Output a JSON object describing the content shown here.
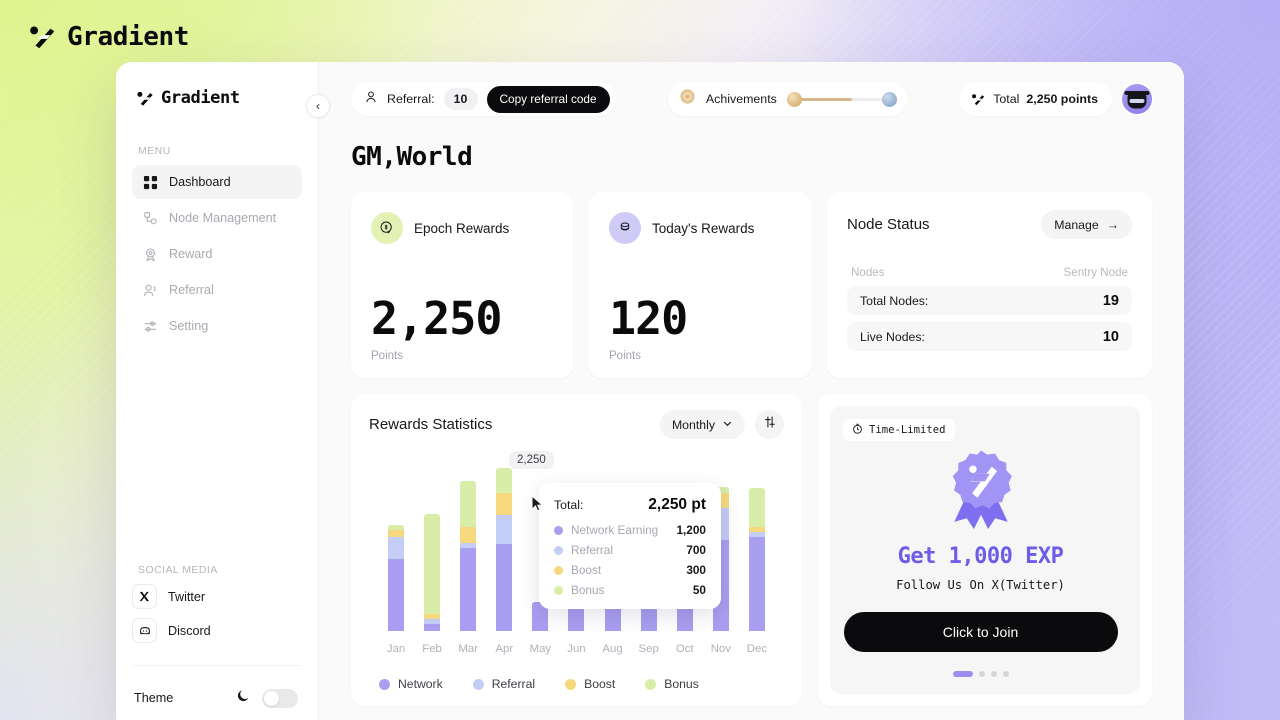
{
  "brand": {
    "name": "Gradient"
  },
  "sidebar": {
    "menu_label": "MENU",
    "items": [
      {
        "label": "Dashboard",
        "icon": "grid-icon"
      },
      {
        "label": "Node Management",
        "icon": "node-icon"
      },
      {
        "label": "Reward",
        "icon": "reward-icon"
      },
      {
        "label": "Referral",
        "icon": "users-icon"
      },
      {
        "label": "Setting",
        "icon": "sliders-icon"
      }
    ],
    "social_label": "SOCIAL MEDIA",
    "social": [
      {
        "label": "Twitter",
        "icon": "x-twitter-icon"
      },
      {
        "label": "Discord",
        "icon": "discord-icon"
      }
    ],
    "theme": {
      "label": "Theme",
      "mode_icon": "moon-icon",
      "enabled": false
    },
    "collapse_icon": "chevron-left-icon"
  },
  "topbar": {
    "referral_label": "Referral:",
    "referral_count": "10",
    "copy_button": "Copy referral code",
    "achievements_label": "Achivements",
    "achievements_progress": 52,
    "total_label": "Total",
    "total_value": "2,250 points",
    "avatar": "user-avatar"
  },
  "page": {
    "title": "GM,World"
  },
  "cards": {
    "epoch": {
      "title": "Epoch Rewards",
      "value": "2,250",
      "unit": "Points",
      "icon": "coins-icon"
    },
    "today": {
      "title": "Today's Rewards",
      "value": "120",
      "unit": "Points",
      "icon": "stack-icon"
    }
  },
  "node_status": {
    "title": "Node Status",
    "manage_label": "Manage",
    "col_left": "Nodes",
    "col_right": "Sentry Node",
    "rows": [
      {
        "label": "Total Nodes:",
        "value": "19"
      },
      {
        "label": "Live Nodes:",
        "value": "10"
      }
    ]
  },
  "stats": {
    "title": "Rewards Statistics",
    "range_label": "Monthly",
    "filter_icon": "sliders-icon",
    "highlight_value": "2,250",
    "tooltip": {
      "total_label": "Total:",
      "total_value": "2,250 pt",
      "rows": [
        {
          "label": "Network Earning",
          "value": "1,200",
          "color": "#a99ef0"
        },
        {
          "label": "Referral",
          "value": "700",
          "color": "#c3cdf6"
        },
        {
          "label": "Boost",
          "value": "300",
          "color": "#f6d97e"
        },
        {
          "label": "Bonus",
          "value": "50",
          "color": "#d8eda8"
        }
      ]
    },
    "legend": [
      {
        "label": "Network",
        "color": "#a99ef0"
      },
      {
        "label": "Referral",
        "color": "#c3cdf6"
      },
      {
        "label": "Boost",
        "color": "#f6d97e"
      },
      {
        "label": "Bonus",
        "color": "#d8eda8"
      }
    ]
  },
  "chart_data": {
    "type": "bar",
    "title": "Rewards Statistics",
    "stacked": true,
    "xlabel": "",
    "ylabel": "",
    "categories": [
      "Jan",
      "Feb",
      "Mar",
      "Apr",
      "May",
      "Jun",
      "Aug",
      "Sep",
      "Oct",
      "Nov",
      "Dec"
    ],
    "series": [
      {
        "name": "Network",
        "color": "#a99ef0",
        "values": [
          1000,
          100,
          1150,
          1200,
          400,
          400,
          400,
          400,
          400,
          1250,
          1300
        ]
      },
      {
        "name": "Referral",
        "color": "#c3cdf6",
        "values": [
          300,
          60,
          60,
          400,
          0,
          0,
          0,
          0,
          0,
          450,
          60
        ]
      },
      {
        "name": "Boost",
        "color": "#f6d97e",
        "values": [
          100,
          70,
          220,
          300,
          0,
          0,
          0,
          0,
          0,
          200,
          80
        ]
      },
      {
        "name": "Bonus",
        "color": "#d8eda8",
        "values": [
          60,
          1380,
          640,
          350,
          0,
          0,
          0,
          0,
          0,
          80,
          530
        ]
      }
    ],
    "highlight": {
      "category": "Apr",
      "total": 2250,
      "unit": "pt"
    },
    "ylim": [
      0,
      2400
    ],
    "grid": false,
    "legend_position": "bottom-left"
  },
  "promo": {
    "badge": "Time-Limited",
    "badge_icon": "timer-icon",
    "medal_icon": "medal-icon",
    "title": "Get 1,000 EXP",
    "subtitle": "Follow Us On X(Twitter)",
    "cta": "Click to Join",
    "slide_count": 4,
    "active_slide": 1
  }
}
